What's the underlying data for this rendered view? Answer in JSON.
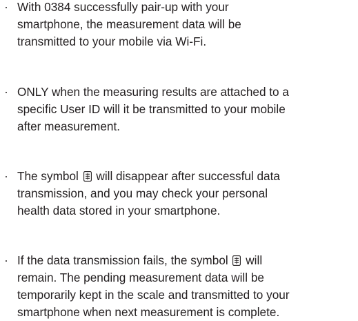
{
  "bullet": "·",
  "items": [
    {
      "lines": [
        "With 0384 successfully pair-up with your",
        "smartphone, the measurement data will be",
        "transmitted to your mobile via Wi-Fi."
      ]
    },
    {
      "lines": [
        "ONLY when the measuring results are attached to a",
        "specific User ID will it be transmitted to your mobile",
        "after measurement."
      ]
    },
    {
      "line1_before": "The symbol",
      "line1_after": "will disappear after successful data",
      "symbol_icon": "data-pending-icon",
      "lines": [
        "transmission, and you may check your personal",
        "health data stored in your smartphone."
      ]
    },
    {
      "line1_before": "If the data transmission fails, the symbol",
      "line1_after": "will",
      "symbol_icon": "data-pending-icon",
      "lines": [
        "remain. The pending measurement data will be",
        "temporarily kept in the scale and transmitted to your",
        "smartphone when next measurement is complete."
      ]
    }
  ]
}
